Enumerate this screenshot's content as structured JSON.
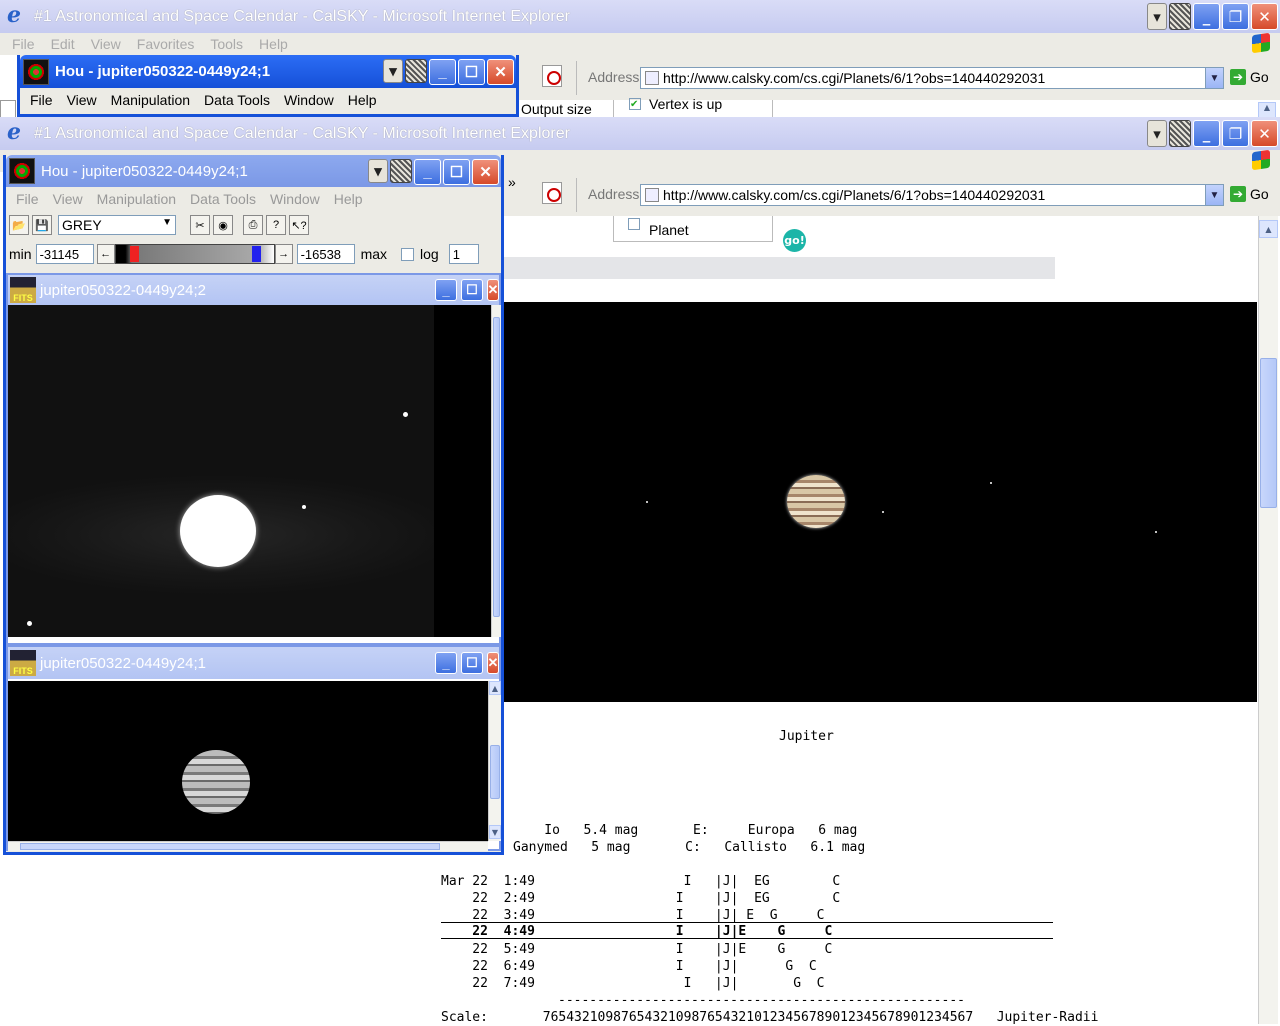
{
  "ie_back": {
    "title": "#1 Astronomical and Space Calendar - CalSKY - Microsoft Internet Explorer",
    "menu": [
      "File",
      "Edit",
      "View",
      "Favorites",
      "Tools",
      "Help"
    ],
    "address_label": "Address",
    "url": "http://www.calsky.com/cs.cgi/Planets/6/1?obs=140440292031",
    "go_label": "Go",
    "form_output_size": "Output size",
    "form_vertex_up": "Vertex is up"
  },
  "hou_back": {
    "title": "Hou - jupiter050322-0449y24;1",
    "menu": [
      "File",
      "View",
      "Manipulation",
      "Data Tools",
      "Window",
      "Help"
    ]
  },
  "ie_front": {
    "title": "#1 Astronomical and Space Calendar - CalSKY - Microsoft Internet Explorer",
    "address_label": "Address",
    "url": "http://www.calsky.com/cs.cgi/Planets/6/1?obs=140440292031",
    "go_label": "Go",
    "chevron": "»",
    "form_planet": "Planet",
    "go_button": "go!"
  },
  "hou_front": {
    "title": "Hou - jupiter050322-0449y24;1",
    "menu": [
      "File",
      "View",
      "Manipulation",
      "Data Tools",
      "Window",
      "Help"
    ],
    "colormap": "GREY",
    "min_label": "min",
    "min_value": "-31145",
    "max_value": "-16538",
    "max_label": "max",
    "log_label": "log",
    "log_value": "1",
    "child1_title": "jupiter050322-0449y24;2",
    "child2_title": "jupiter050322-0449y24;1",
    "fits": "FITS"
  },
  "page": {
    "jupiter_label": "Jupiter",
    "moons_line1": "    Io   5.4 mag       E:     Europa   6 mag",
    "moons_line2": "Ganymed   5 mag       C:   Callisto   6.1 mag",
    "rows": [
      "Mar 22  1:49                   I   |J|  EG        C",
      "    22  2:49                  I    |J|  EG        C",
      "    22  3:49                  I    |J| E  G     C",
      "    22  4:49                  I    |J|E    G     C",
      "    22  5:49                  I    |J|E    G     C",
      "    22  6:49                  I    |J|      G  C",
      "    22  7:49                   I   |J|       G  C"
    ],
    "dashes": "----------------------------------------------------",
    "scale_line": "Scale:       7654321098765432109876543210123456789012345678901234567   Jupiter-Radii"
  }
}
